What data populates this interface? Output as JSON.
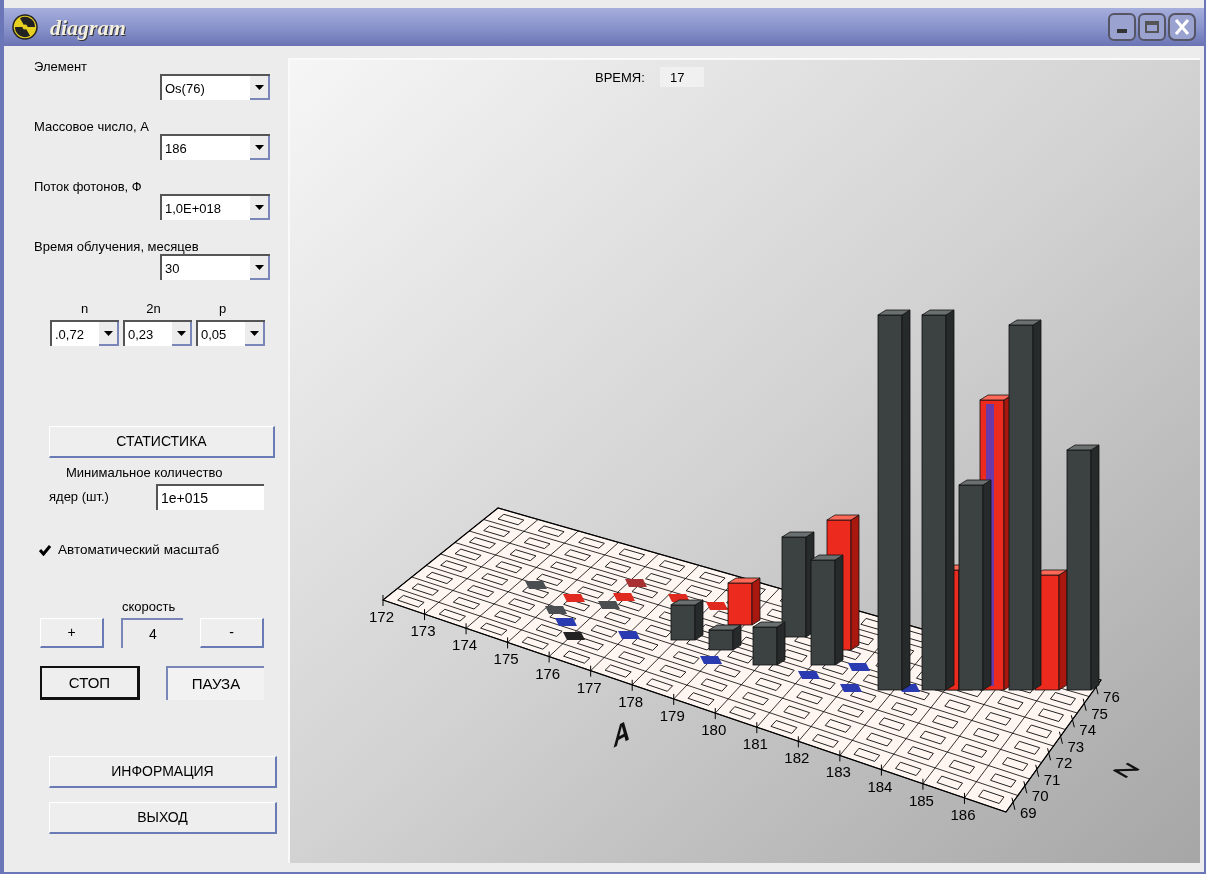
{
  "window": {
    "title": "diagram"
  },
  "selectors": [
    {
      "label": "Элемент",
      "value": "Os(76)"
    },
    {
      "label": "Массовое число, А",
      "value": "186"
    },
    {
      "label": "Поток фотонов, Ф",
      "value": "1,0E+018"
    },
    {
      "label": "Время облучения, месяцев",
      "value": "30"
    }
  ],
  "branching": [
    {
      "label": "n",
      "value": ".0,72"
    },
    {
      "label": "2n",
      "value": "0,23"
    },
    {
      "label": "p",
      "value": "0,05"
    }
  ],
  "statistics_button": "СТАТИСТИКА",
  "min_nuclei": {
    "label_line1": "Минимальное количество",
    "label_line2": "ядер (шт.)",
    "value": "1e+015"
  },
  "auto_scale": {
    "label": "Автоматический масштаб",
    "checked": true
  },
  "speed": {
    "label": "скорость",
    "plus": "+",
    "value": "4",
    "minus": "-"
  },
  "run_buttons": [
    {
      "label": "СТОП",
      "pressed": false
    },
    {
      "label": "ПАУЗА",
      "pressed": true
    }
  ],
  "info_button": "ИНФОРМАЦИЯ",
  "exit_button": "ВЫХОД",
  "chart": {
    "time_label": "ВРЕМЯ:",
    "time_value": "17",
    "x_ticks": [
      "172",
      "173",
      "174",
      "175",
      "176",
      "177",
      "178",
      "179",
      "180",
      "181",
      "182",
      "183",
      "184",
      "185",
      "186"
    ],
    "z_ticks": [
      "69",
      "70",
      "71",
      "72",
      "73",
      "74",
      "75",
      "76"
    ],
    "x_axis_title": "A",
    "z_axis_title": "Z"
  }
}
